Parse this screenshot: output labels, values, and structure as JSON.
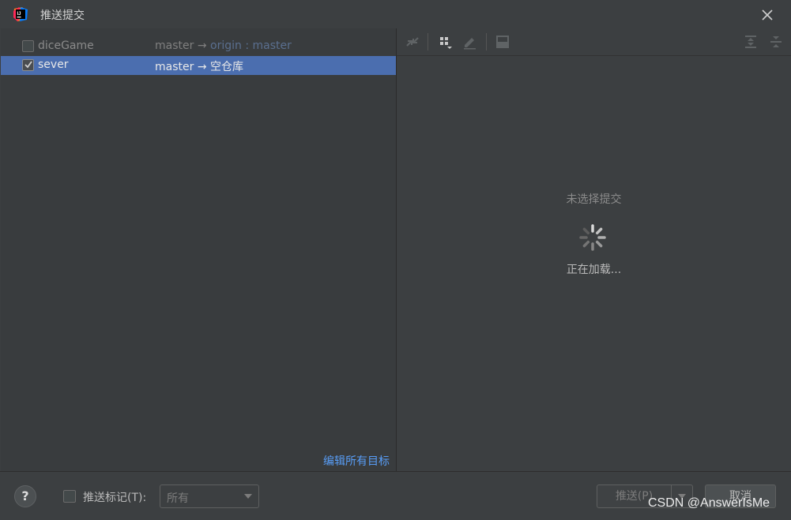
{
  "window": {
    "title": "推送提交",
    "app_icon": "intellij-idea-icon",
    "close_icon": "close-icon"
  },
  "repos": [
    {
      "name": "diceGame",
      "checked": false,
      "selected": false,
      "local_branch": "master",
      "arrow": "→",
      "remote": "origin",
      "separator": " : ",
      "remote_branch": "master"
    },
    {
      "name": "sever",
      "checked": true,
      "selected": true,
      "local_branch": "master",
      "arrow": "→",
      "target": "空仓库"
    }
  ],
  "left_panel": {
    "edit_all_targets": "编辑所有目标"
  },
  "toolbar": {
    "icons": [
      "collapse-icon",
      "group-by-icon",
      "edit-icon",
      "preview-icon",
      "expand-all-icon",
      "collapse-all-icon"
    ]
  },
  "details": {
    "empty_message": "未选择提交",
    "loading_text": "正在加载..."
  },
  "bottom": {
    "help_label": "?",
    "push_tags_label": "推送标记(T):",
    "push_tags_checked": false,
    "tags_select_value": "所有",
    "push_button": "推送(P)",
    "cancel_button": "取消"
  },
  "watermark": "CSDN @AnswerIsMe",
  "colors": {
    "background": "#3c3f41",
    "selection": "#4b6eaf",
    "link": "#589df6",
    "remote_link": "#5a6f8f"
  }
}
